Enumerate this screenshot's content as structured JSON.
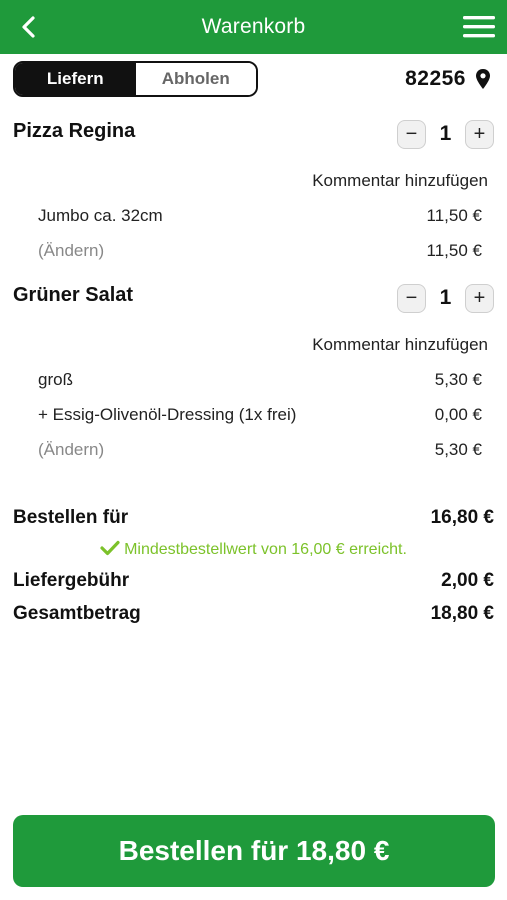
{
  "header": {
    "title": "Warenkorb",
    "back_icon": "chevron-left-icon",
    "menu_icon": "hamburger-menu-icon"
  },
  "delivery_toggle": {
    "options": [
      "Liefern",
      "Abholen"
    ],
    "selected": "Liefern"
  },
  "location": {
    "zip": "82256",
    "icon": "map-pin-icon"
  },
  "cart": {
    "items": [
      {
        "name": "Pizza Regina",
        "quantity": "1",
        "comment_label": "Kommentar hinzufügen",
        "lines": [
          {
            "label": "Jumbo ca. 32cm",
            "price": "11,50 €"
          },
          {
            "label": "(Ändern)",
            "price": "11,50 €"
          }
        ]
      },
      {
        "name": "Grüner Salat",
        "quantity": "1",
        "comment_label": "Kommentar hinzufügen",
        "lines": [
          {
            "label": "groß",
            "price": "5,30 €"
          },
          {
            "label": "+ Essig-Olivenöl-Dressing (1x frei)",
            "price": "0,00 €"
          },
          {
            "label": "(Ändern)",
            "price": "5,30 €"
          }
        ]
      }
    ]
  },
  "summary": {
    "subtotal_label": "Bestellen für",
    "subtotal": "16,80 €",
    "min_order_message": "Mindestbestellwert von 16,00 € erreicht.",
    "delivery_fee_label": "Liefergebühr",
    "delivery_fee": "2,00 €",
    "total_label": "Gesamtbetrag",
    "total": "18,80 €"
  },
  "order_button": {
    "label": "Bestellen für 18,80 €"
  },
  "colors": {
    "primary": "#1f9a3b",
    "success": "#7cc22a",
    "dark": "#111111"
  }
}
